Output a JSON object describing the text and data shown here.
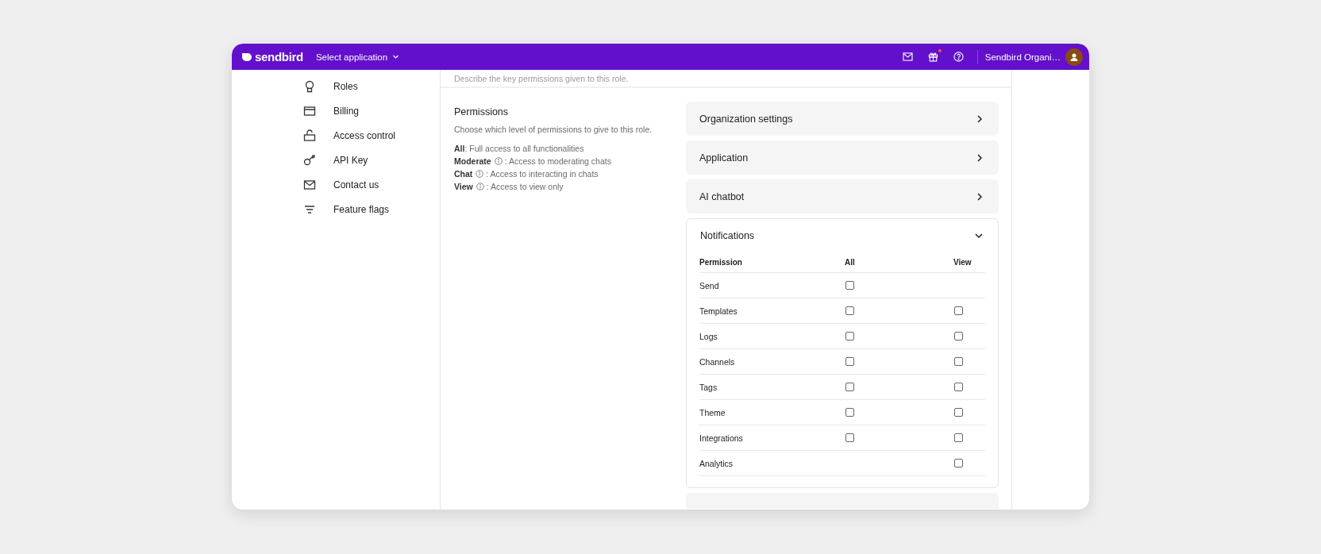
{
  "topbar": {
    "brand": "sendbird",
    "app_selector": "Select application",
    "gift_has_notification": true,
    "org_name": "Sendbird Organi…"
  },
  "sidebar": {
    "items": [
      {
        "label": "Roles"
      },
      {
        "label": "Billing"
      },
      {
        "label": "Access control"
      },
      {
        "label": "API Key"
      },
      {
        "label": "Contact us"
      },
      {
        "label": "Feature flags"
      }
    ]
  },
  "content": {
    "description_hint": "Describe the key permissions given to this role.",
    "permissions": {
      "title": "Permissions",
      "subtitle": "Choose which level of permissions to give to this role.",
      "levels": [
        {
          "name": "All",
          "info_icon": false,
          "description": ": Full access to all functionalities"
        },
        {
          "name": "Moderate",
          "info_icon": true,
          "description": ": Access to moderating chats"
        },
        {
          "name": "Chat",
          "info_icon": true,
          "description": ": Access to interacting in chats"
        },
        {
          "name": "View",
          "info_icon": true,
          "description": ": Access to view only"
        }
      ]
    },
    "sections": [
      {
        "title": "Organization settings",
        "expanded": false
      },
      {
        "title": "Application",
        "expanded": false
      },
      {
        "title": "AI chatbot",
        "expanded": false
      },
      {
        "title": "Notifications",
        "expanded": true,
        "table": {
          "columns": [
            "Permission",
            "All",
            "View"
          ],
          "rows": [
            {
              "name": "Send",
              "all": false
            },
            {
              "name": "Templates",
              "all": false,
              "view": false
            },
            {
              "name": "Logs",
              "all": false,
              "view": false
            },
            {
              "name": "Channels",
              "all": false,
              "view": false
            },
            {
              "name": "Tags",
              "all": false,
              "view": false
            },
            {
              "name": "Theme",
              "all": false,
              "view": false
            },
            {
              "name": "Integrations",
              "all": false,
              "view": false
            },
            {
              "name": "Analytics",
              "view": false
            }
          ]
        }
      }
    ]
  }
}
